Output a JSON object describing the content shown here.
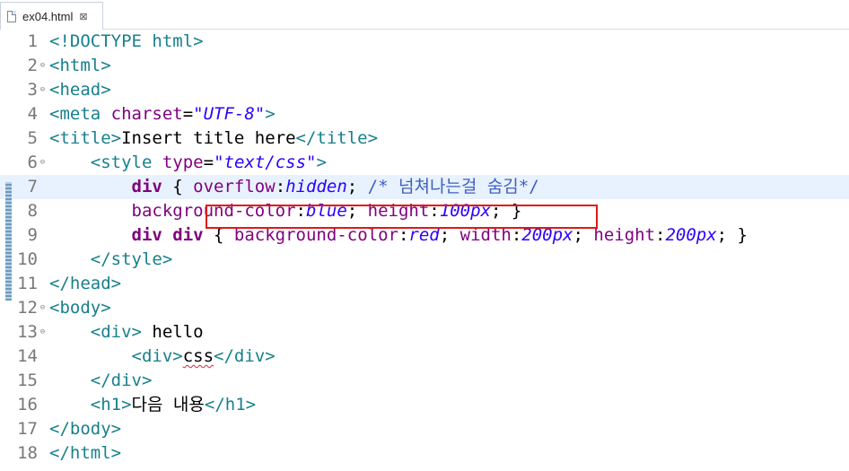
{
  "tab": {
    "filename": "ex04.html",
    "close_glyph": "⊠"
  },
  "lines": [
    {
      "num": "1",
      "fold": "",
      "current": false,
      "tokens": [
        {
          "c": "tag",
          "t": "<!DOCTYPE html>"
        }
      ]
    },
    {
      "num": "2",
      "fold": "⊖",
      "current": false,
      "tokens": [
        {
          "c": "tag",
          "t": "<html>"
        }
      ]
    },
    {
      "num": "3",
      "fold": "⊖",
      "current": false,
      "tokens": [
        {
          "c": "tag",
          "t": "<head>"
        }
      ]
    },
    {
      "num": "4",
      "fold": "",
      "current": false,
      "tokens": [
        {
          "c": "tag",
          "t": "<meta "
        },
        {
          "c": "attr",
          "t": "charset"
        },
        {
          "c": "txt",
          "t": "="
        },
        {
          "c": "str",
          "t": "\"UTF-8\""
        },
        {
          "c": "tag",
          "t": ">"
        }
      ]
    },
    {
      "num": "5",
      "fold": "",
      "current": false,
      "tokens": [
        {
          "c": "tag",
          "t": "<title>"
        },
        {
          "c": "txt",
          "t": "Insert title here"
        },
        {
          "c": "tag",
          "t": "</title>"
        }
      ]
    },
    {
      "num": "6",
      "fold": "⊖",
      "current": false,
      "tokens": [
        {
          "c": "txt",
          "t": "    "
        },
        {
          "c": "tag",
          "t": "<style "
        },
        {
          "c": "attr",
          "t": "type"
        },
        {
          "c": "txt",
          "t": "="
        },
        {
          "c": "str",
          "t": "\"text/css\""
        },
        {
          "c": "tag",
          "t": ">"
        }
      ]
    },
    {
      "num": "7",
      "fold": "",
      "current": true,
      "tokens": [
        {
          "c": "txt",
          "t": "        "
        },
        {
          "c": "sel",
          "t": "div"
        },
        {
          "c": "txt",
          "t": " { "
        },
        {
          "c": "prop",
          "t": "overflow"
        },
        {
          "c": "txt",
          "t": ":"
        },
        {
          "c": "val",
          "t": "hidden"
        },
        {
          "c": "txt",
          "t": "; "
        },
        {
          "c": "cmt",
          "t": "/* 넘쳐나는걸 숨김*/"
        }
      ]
    },
    {
      "num": "8",
      "fold": "",
      "current": false,
      "tokens": [
        {
          "c": "txt",
          "t": "        "
        },
        {
          "c": "prop",
          "t": "background-color"
        },
        {
          "c": "txt",
          "t": ":"
        },
        {
          "c": "val",
          "t": "blue"
        },
        {
          "c": "txt",
          "t": "; "
        },
        {
          "c": "prop",
          "t": "height"
        },
        {
          "c": "txt",
          "t": ":"
        },
        {
          "c": "val",
          "t": "100px"
        },
        {
          "c": "txt",
          "t": "; }"
        }
      ]
    },
    {
      "num": "9",
      "fold": "",
      "current": false,
      "tokens": [
        {
          "c": "txt",
          "t": "        "
        },
        {
          "c": "sel",
          "t": "div div"
        },
        {
          "c": "txt",
          "t": " { "
        },
        {
          "c": "prop",
          "t": "background-color"
        },
        {
          "c": "txt",
          "t": ":"
        },
        {
          "c": "val",
          "t": "red"
        },
        {
          "c": "txt",
          "t": "; "
        },
        {
          "c": "prop",
          "t": "width"
        },
        {
          "c": "txt",
          "t": ":"
        },
        {
          "c": "val",
          "t": "200px"
        },
        {
          "c": "txt",
          "t": "; "
        },
        {
          "c": "prop",
          "t": "height"
        },
        {
          "c": "txt",
          "t": ":"
        },
        {
          "c": "val",
          "t": "200px"
        },
        {
          "c": "txt",
          "t": "; }"
        }
      ]
    },
    {
      "num": "10",
      "fold": "",
      "current": false,
      "tokens": [
        {
          "c": "txt",
          "t": "    "
        },
        {
          "c": "tag",
          "t": "</style>"
        }
      ]
    },
    {
      "num": "11",
      "fold": "",
      "current": false,
      "tokens": [
        {
          "c": "tag",
          "t": "</head>"
        }
      ]
    },
    {
      "num": "12",
      "fold": "⊖",
      "current": false,
      "tokens": [
        {
          "c": "tag",
          "t": "<body>"
        }
      ]
    },
    {
      "num": "13",
      "fold": "⊖",
      "current": false,
      "tokens": [
        {
          "c": "txt",
          "t": "    "
        },
        {
          "c": "tag",
          "t": "<div>"
        },
        {
          "c": "txt",
          "t": " hello"
        }
      ]
    },
    {
      "num": "14",
      "fold": "",
      "current": false,
      "tokens": [
        {
          "c": "txt",
          "t": "        "
        },
        {
          "c": "tag",
          "t": "<div>"
        },
        {
          "c": "txt squig",
          "t": "css"
        },
        {
          "c": "tag",
          "t": "</div>"
        }
      ]
    },
    {
      "num": "15",
      "fold": "",
      "current": false,
      "tokens": [
        {
          "c": "txt",
          "t": "    "
        },
        {
          "c": "tag",
          "t": "</div>"
        }
      ]
    },
    {
      "num": "16",
      "fold": "",
      "current": false,
      "tokens": [
        {
          "c": "txt",
          "t": "    "
        },
        {
          "c": "tag",
          "t": "<h1>"
        },
        {
          "c": "txt",
          "t": "다음 내용"
        },
        {
          "c": "tag",
          "t": "</h1>"
        }
      ]
    },
    {
      "num": "17",
      "fold": "",
      "current": false,
      "tokens": [
        {
          "c": "tag",
          "t": "</body>"
        }
      ]
    },
    {
      "num": "18",
      "fold": "",
      "current": false,
      "tokens": [
        {
          "c": "tag",
          "t": "</html>"
        }
      ]
    }
  ]
}
